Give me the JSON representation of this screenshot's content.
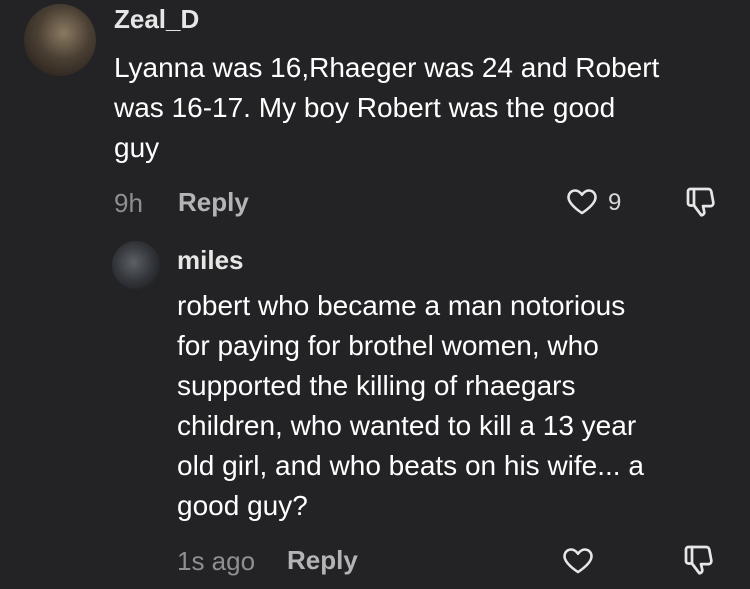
{
  "comments": [
    {
      "username": "Zeal_D",
      "text": "Lyanna was 16,Rhaeger was 24 and Robert\nwas 16-17. My boy Robert was the good\nguy",
      "time": "9h",
      "reply_label": "Reply",
      "like_count": "9",
      "avatar_icon": "user-avatar-icon"
    },
    {
      "username": "miles",
      "text": "robert who became a man notorious\nfor paying for brothel women, who\nsupported the killing of rhaegars\nchildren, who wanted to kill a 13 year\nold girl, and who beats on his wife... a\ngood guy?",
      "time": "1s ago",
      "reply_label": "Reply",
      "avatar_icon": "user-avatar-icon"
    }
  ],
  "icons": {
    "like": "heart-outline-icon",
    "dislike": "thumbs-down-outline-icon"
  },
  "colors": {
    "background": "#232325",
    "text_primary": "#ffffff",
    "text_secondary": "#8e8e93"
  }
}
